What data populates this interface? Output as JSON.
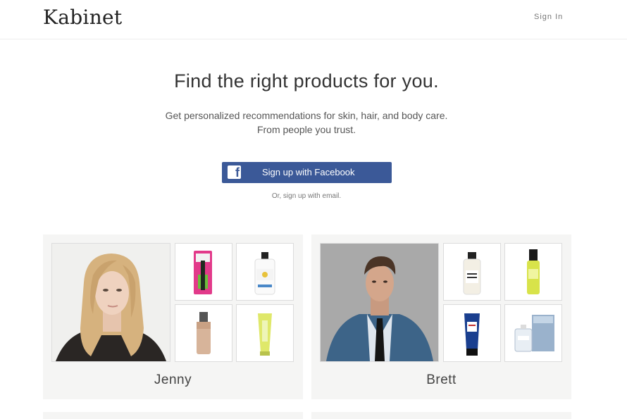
{
  "header": {
    "logo": "Kabinet",
    "signin_label": "Sign In"
  },
  "hero": {
    "title": "Find the right products for you.",
    "subtitle_line1": "Get personalized recommendations for skin, hair, and body care.",
    "subtitle_line2": "From people you trust.",
    "facebook_button_label": "Sign up with Facebook",
    "email_link": "Or, sign up with email."
  },
  "cards": [
    {
      "name": "Jenny",
      "products": [
        "mascara",
        "face-lotion",
        "foundation",
        "tube-cream"
      ]
    },
    {
      "name": "Brett",
      "products": [
        "lotion-bottle",
        "pump-bottle",
        "blue-tube",
        "cologne-box"
      ]
    }
  ],
  "colors": {
    "facebook": "#3b5998",
    "card_bg": "#f5f5f4"
  }
}
